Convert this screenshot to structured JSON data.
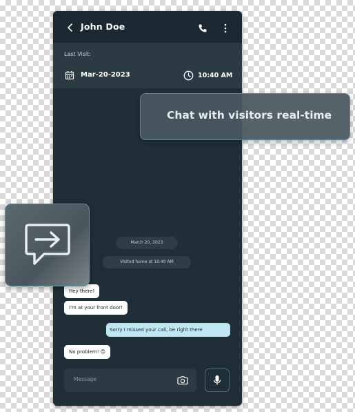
{
  "header": {
    "title": "John Doe"
  },
  "visit": {
    "label": "Last Visit:",
    "date": "Mar-20-2023",
    "time": "10:40 AM"
  },
  "chat": {
    "date_chip": "March 20, 2023",
    "visit_chip": "Visited home at 10:40 AM",
    "messages": [
      {
        "text": "Hey there!",
        "direction": "incoming"
      },
      {
        "text": "I'm at your front door!",
        "direction": "incoming"
      },
      {
        "text": "Sorry I missed your call, be right there",
        "direction": "outgoing"
      },
      {
        "text": "No problem! 😊",
        "direction": "incoming"
      }
    ]
  },
  "composer": {
    "placeholder": "Message"
  },
  "callout": {
    "text": "Chat with visitors real-time"
  },
  "icons": [
    "chevron-left-icon",
    "phone-icon",
    "more-vertical-icon",
    "calendar-icon",
    "clock-icon",
    "camera-icon",
    "mic-icon",
    "message-arrow-icon"
  ],
  "colors": {
    "phone_bg": "#1f2e37",
    "header_bg": "#1b2831",
    "visit_bar_bg": "#2b3a43",
    "incoming_bubble": "#ffffff",
    "outgoing_bubble": "#bfe7f2",
    "accent_border": "#5f8596"
  }
}
